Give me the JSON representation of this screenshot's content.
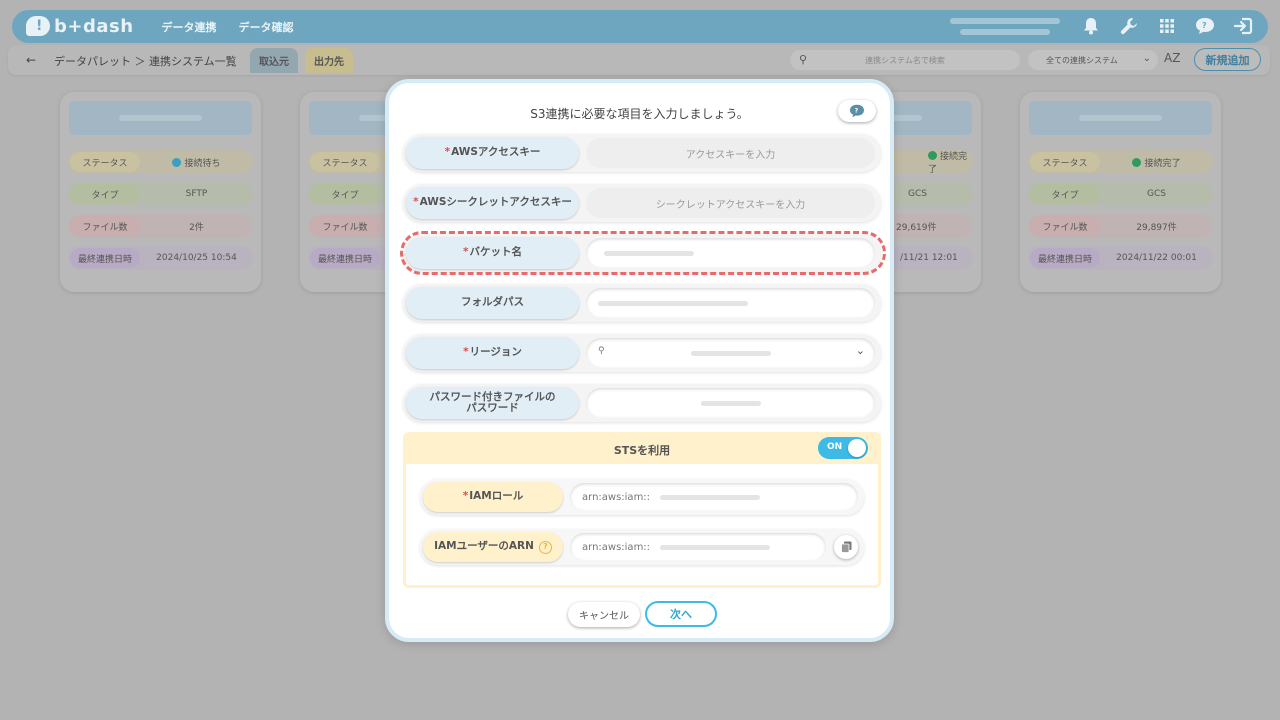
{
  "header": {
    "logo_text": "b+dash",
    "nav": [
      "データ連携",
      "データ確認"
    ]
  },
  "subbar": {
    "breadcrumb": "データパレット ＞ 連携システム一覧",
    "tabs": [
      "取込元",
      "出力先"
    ],
    "search_placeholder": "連携システム名で検索",
    "filter_value": "全ての連携システム",
    "sort_label": "AZ",
    "add_button": "新規追加"
  },
  "cards": [
    {
      "status": "接続待ち",
      "type": "SFTP",
      "files": "2件",
      "last_sync": "2024/10/25 10:54",
      "status_color": "#3a9fc6"
    },
    {
      "status": "",
      "type": "",
      "files": "",
      "last_sync": "",
      "status_color": "#3a9fc6"
    },
    {
      "status": "接続完了",
      "type": "GCS",
      "files": "29,619件",
      "last_sync": "/11/21 12:01",
      "status_color": "#2e9a5d"
    },
    {
      "status": "接続完了",
      "type": "GCS",
      "files": "29,897件",
      "last_sync": "2024/11/22 00:01",
      "status_color": "#2e9a5d"
    }
  ],
  "card_labels": {
    "status": "ステータス",
    "type": "タイプ",
    "files": "ファイル数",
    "last_sync": "最終連携日時"
  },
  "modal": {
    "title": "S3連携に必要な項目を入力しましょう。",
    "fields": {
      "access_key": {
        "label": "AWSアクセスキー",
        "placeholder": "アクセスキーを入力"
      },
      "secret_key": {
        "label": "AWSシークレットアクセスキー",
        "placeholder": "シークレットアクセスキーを入力"
      },
      "bucket": {
        "label": "バケット名"
      },
      "folder": {
        "label": "フォルダパス"
      },
      "region": {
        "label": "リージョン"
      },
      "password": {
        "label_line1": "パスワード付きファイルの",
        "label_line2": "パスワード"
      }
    },
    "required_mark": "*",
    "sts": {
      "label": "STSを利用",
      "toggle": "ON",
      "iam_role_label": "IAMロール",
      "iam_role_prefix": "arn:aws:iam::",
      "iam_user_label": "IAMユーザーのARN",
      "iam_user_prefix": "arn:aws:iam::",
      "help_glyph": "?"
    },
    "cancel_button": "キャンセル",
    "next_button": "次へ"
  }
}
